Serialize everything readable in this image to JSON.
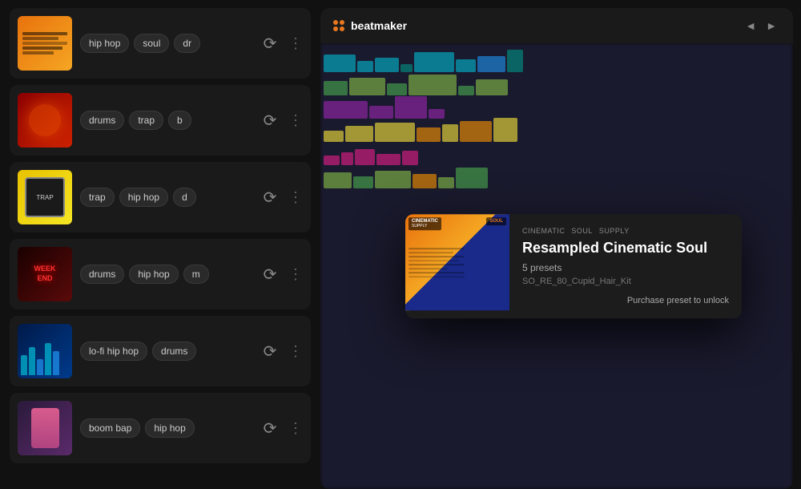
{
  "app": {
    "name": "beatmaker"
  },
  "packs": [
    {
      "id": "pack-1",
      "thumb_class": "thumb-orange",
      "tags": [
        "hip hop",
        "soul",
        "dr"
      ],
      "action": "export"
    },
    {
      "id": "pack-2",
      "thumb_class": "thumb-red",
      "tags": [
        "drums",
        "trap",
        "b"
      ],
      "action": "export"
    },
    {
      "id": "pack-3",
      "thumb_class": "thumb-yellow",
      "tags": [
        "trap",
        "hip hop",
        "d"
      ],
      "action": "export"
    },
    {
      "id": "pack-4",
      "thumb_class": "thumb-dark-red",
      "tags": [
        "drums",
        "hip hop",
        "m"
      ],
      "action": "export",
      "label": "WEEKEND"
    },
    {
      "id": "pack-5",
      "thumb_class": "thumb-blue",
      "tags": [
        "lo-fi hip hop",
        "drums"
      ],
      "action": "export"
    },
    {
      "id": "pack-6",
      "thumb_class": "thumb-pink",
      "tags": [
        "boom bap",
        "hip hop"
      ],
      "action": "export"
    }
  ],
  "popup": {
    "title": "Resampled Cinematic Soul",
    "presets": "5 presets",
    "filename": "SO_RE_80_Cupid_Hair_Kit",
    "purchase_label": "Purchase preset to unlock",
    "small_label_1": "CINEMATIC",
    "small_label_2": "SOUL",
    "small_label_3": "SUPPLY"
  },
  "nav": {
    "back": "◄",
    "forward": "►"
  }
}
